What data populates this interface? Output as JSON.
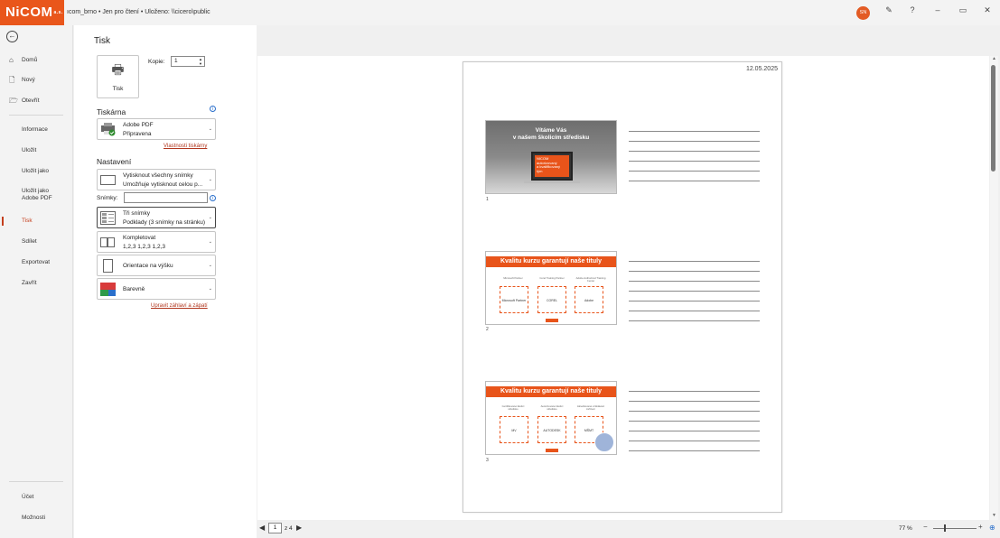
{
  "titlebar": {
    "logo": "NiCOM",
    "logo_small": "a.s.",
    "document": "ıcom_brno  •  Jen pro čtení  •  Uloženo: \\\\cicero\\public",
    "user_initials": "SN",
    "help": "?",
    "minimize": "–",
    "restore": "▭",
    "close": "✕"
  },
  "nav": {
    "back": "←",
    "items": [
      {
        "label": "Domů",
        "icon": "⌂"
      },
      {
        "label": "Nový",
        "icon": "🗋"
      },
      {
        "label": "Otevřít",
        "icon": "🗁"
      },
      {
        "label": "Informace"
      },
      {
        "label": "Uložit"
      },
      {
        "label": "Uložit jako"
      },
      {
        "label": "Uložit jako Adobe PDF"
      },
      {
        "label": "Tisk"
      },
      {
        "label": "Sdílet"
      },
      {
        "label": "Exportovat"
      },
      {
        "label": "Zavřít"
      },
      {
        "label": "Účet"
      },
      {
        "label": "Možnosti"
      }
    ]
  },
  "print": {
    "title": "Tisk",
    "button_label": "Tisk",
    "copies_label": "Kopie:",
    "copies_value": "1",
    "printer_heading": "Tiskárna",
    "printer_name": "Adobe PDF",
    "printer_status": "Připravena",
    "printer_properties": "Vlastnosti tiskárny",
    "settings_heading": "Nastavení",
    "range_l1": "Vytisknout všechny snímky",
    "range_l2": "Umožňuje vytisknout celou p...",
    "slides_label": "Snímky:",
    "slides_value": "",
    "layout_l1": "Tři snímky",
    "layout_l2": "Podklady (3 snímky na stránku)",
    "collate_l1": "Kompletovat",
    "collate_l2": "1,2,3    1,2,3    1,2,3",
    "orientation": "Orientace na výšku",
    "color": "Barevně",
    "header_footer_link": "Upravit záhlaví a zápatí",
    "info": "i"
  },
  "preview": {
    "date": "12.05.2025",
    "slides": [
      {
        "num": "1",
        "title": "Vítáme Vás\nv našem školicím středisku",
        "screen_text": "NICOM\nautorizovaný\na kvalifikovaný\ntým"
      },
      {
        "num": "2",
        "title": "Kvalitu kurzu garantují naše tituly",
        "captions": [
          "Microsoft Partner",
          "Corel Training Partner",
          "Adobe Authorized Training Center"
        ],
        "logos": [
          "Microsoft Partner",
          "COREL",
          "Adobe"
        ]
      },
      {
        "num": "3",
        "title": "Kvalitu kurzu garantují naše tituly",
        "captions": [
          "Certifikované školicí středisko",
          "Autorizované školicí středisko",
          "Akreditované vzdělávací zařízení"
        ],
        "logos": [
          "MV",
          "AUTODESK",
          "MŠMT"
        ]
      }
    ]
  },
  "bottombar": {
    "prev": "◀",
    "page": "1",
    "total": "z 4",
    "next": "▶",
    "zoom": "77 %",
    "zoom_minus": "−",
    "zoom_plus": "+",
    "fit": "⊕"
  },
  "scroll": {
    "up": "▲",
    "down": "▼"
  }
}
